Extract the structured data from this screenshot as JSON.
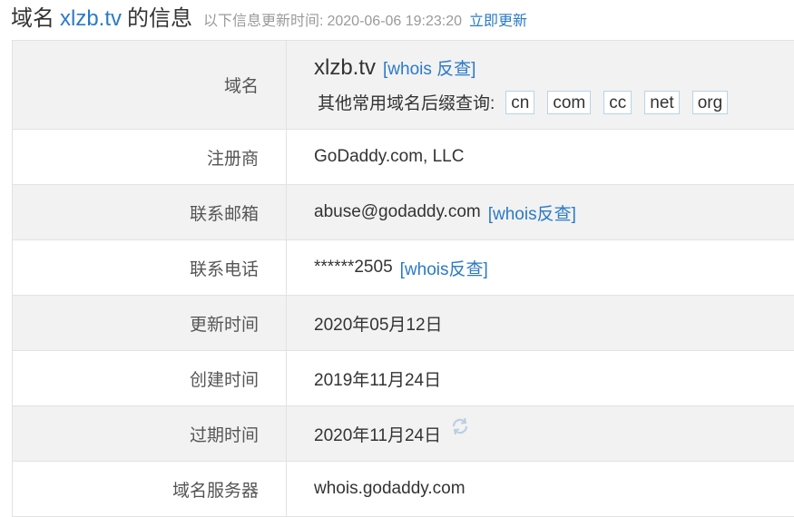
{
  "header": {
    "title_prefix": "域名",
    "domain": "xlzb.tv",
    "title_suffix": "的信息",
    "sub": "以下信息更新时间:",
    "time": "2020-06-06 19:23:20",
    "refresh": "立即更新"
  },
  "domain_row": {
    "label": "域名",
    "domain": "xlzb.tv",
    "whois_link": "[whois 反查]",
    "suffix_label": "其他常用域名后缀查询:",
    "suffixes": [
      "cn",
      "com",
      "cc",
      "net",
      "org"
    ]
  },
  "rows": [
    {
      "label": "注册商",
      "value": "GoDaddy.com, LLC",
      "link": ""
    },
    {
      "label": "联系邮箱",
      "value": "abuse@godaddy.com",
      "link": "[whois反查]"
    },
    {
      "label": "联系电话",
      "value": "******2505",
      "link": "[whois反查]"
    },
    {
      "label": "更新时间",
      "value": "2020年05月12日",
      "link": ""
    },
    {
      "label": "创建时间",
      "value": "2019年11月24日",
      "link": ""
    },
    {
      "label": "过期时间",
      "value": "2020年11月24日",
      "link": ""
    },
    {
      "label": "域名服务器",
      "value": "whois.godaddy.com",
      "link": ""
    }
  ],
  "icons": {
    "expire_refresh": "refresh-icon"
  },
  "colors": {
    "link": "#2a7ac8",
    "row_gray": "#f2f2f2",
    "border": "#e2e2e2"
  }
}
